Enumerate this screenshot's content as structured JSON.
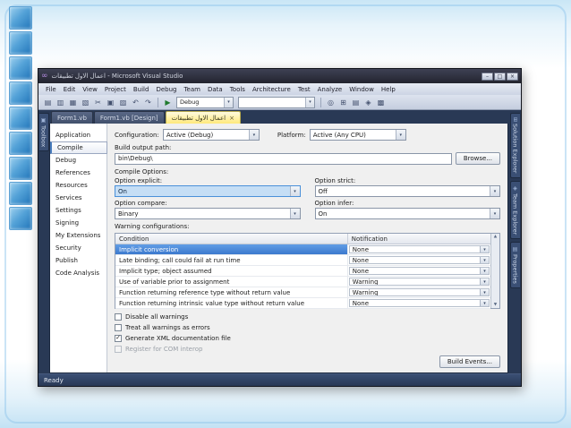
{
  "window": {
    "title": "اعمال الاول تطبيقات - Microsoft Visual Studio",
    "controls": {
      "minimize": "–",
      "maximize": "□",
      "close": "×"
    },
    "menu": [
      "File",
      "Edit",
      "View",
      "Project",
      "Build",
      "Debug",
      "Team",
      "Data",
      "Tools",
      "Architecture",
      "Test",
      "Analyze",
      "Window",
      "Help"
    ],
    "toolbar": {
      "left_icons": [
        {
          "name": "new-file-icon",
          "glyph": "▤"
        },
        {
          "name": "open-file-icon",
          "glyph": "▥"
        },
        {
          "name": "save-icon",
          "glyph": "▦"
        },
        {
          "name": "save-all-icon",
          "glyph": "▧"
        },
        {
          "name": "cut-icon",
          "glyph": "✂"
        },
        {
          "name": "copy-icon",
          "glyph": "▣"
        },
        {
          "name": "paste-icon",
          "glyph": "▨"
        },
        {
          "name": "undo-icon",
          "glyph": "↶"
        },
        {
          "name": "redo-icon",
          "glyph": "↷"
        }
      ],
      "run_glyph": "▶",
      "config_combo": "Debug",
      "right_icons": [
        {
          "name": "find-icon",
          "glyph": "◎"
        },
        {
          "name": "solution-explorer-icon",
          "glyph": "⊞"
        },
        {
          "name": "properties-window-icon",
          "glyph": "▤"
        },
        {
          "name": "object-browser-icon",
          "glyph": "◈"
        },
        {
          "name": "extension-manager-icon",
          "glyph": "▩"
        }
      ]
    },
    "left_tab": "Toolbox",
    "left_tab_icon": "▣",
    "doc_tabs": [
      {
        "label": "Form1.vb"
      },
      {
        "label": "Form1.vb [Design]"
      },
      {
        "label": "اعمال الاول تطبيقات",
        "active": true
      }
    ],
    "right_tabs": [
      {
        "label": "Solution Explorer",
        "icon": "⊞"
      },
      {
        "label": "Team Explorer",
        "icon": "◈"
      },
      {
        "label": "Properties",
        "icon": "▤"
      }
    ],
    "status": "Ready"
  },
  "properties_page": {
    "side_tabs": [
      {
        "label": "Application"
      },
      {
        "label": "Compile",
        "active": true
      },
      {
        "label": "Debug"
      },
      {
        "label": "References"
      },
      {
        "label": "Resources"
      },
      {
        "label": "Services"
      },
      {
        "label": "Settings"
      },
      {
        "label": "Signing"
      },
      {
        "label": "My Extensions"
      },
      {
        "label": "Security"
      },
      {
        "label": "Publish"
      },
      {
        "label": "Code Analysis"
      }
    ],
    "configuration": {
      "label": "Configuration:",
      "value": "Active (Debug)"
    },
    "platform": {
      "label": "Platform:",
      "value": "Active (Any CPU)"
    },
    "build_output": {
      "label": "Build output path:",
      "value": "bin\\Debug\\",
      "browse": "Browse..."
    },
    "compile_options": {
      "heading": "Compile Options:",
      "fields": [
        {
          "label": "Option explicit:",
          "value": "On",
          "focused": true
        },
        {
          "label": "Option strict:",
          "value": "Off"
        },
        {
          "label": "Option compare:",
          "value": "Binary"
        },
        {
          "label": "Option infer:",
          "value": "On"
        }
      ]
    },
    "warnings": {
      "heading": "Warning configurations:",
      "columns": [
        "Condition",
        "Notification"
      ],
      "rows": [
        {
          "condition": "Implicit conversion",
          "notification": "None",
          "selected": true
        },
        {
          "condition": "Late binding; call could fail at run time",
          "notification": "None"
        },
        {
          "condition": "Implicit type; object assumed",
          "notification": "None"
        },
        {
          "condition": "Use of variable prior to assignment",
          "notification": "Warning"
        },
        {
          "condition": "Function returning reference type without return value",
          "notification": "Warning"
        },
        {
          "condition": "Function returning intrinsic value type without return value",
          "notification": "None"
        }
      ]
    },
    "checkboxes": [
      {
        "label": "Disable all warnings",
        "checked": false
      },
      {
        "label": "Treat all warnings as errors",
        "checked": false
      },
      {
        "label": "Generate XML documentation file",
        "checked": true
      },
      {
        "label": "Register for COM interop",
        "checked": false,
        "disabled": true
      }
    ],
    "build_events_button": "Build Events..."
  }
}
